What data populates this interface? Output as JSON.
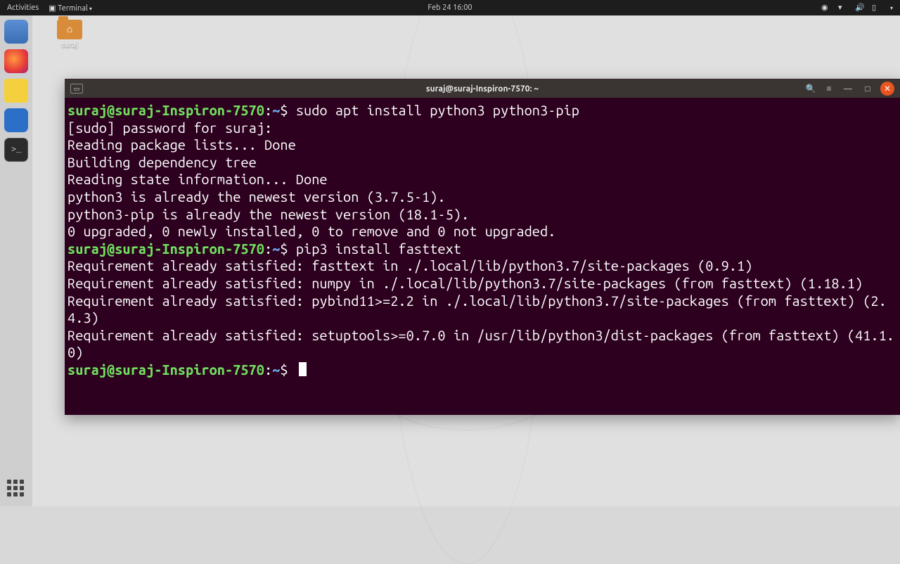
{
  "topbar": {
    "activities": "Activities",
    "app_menu": "Terminal",
    "clock": "Feb 24 16:00"
  },
  "desktop": {
    "folder_label": "suraj"
  },
  "window": {
    "title": "suraj@suraj-Inspiron-7570: ~"
  },
  "terminal": {
    "prompt_user": "suraj@suraj-Inspiron-7570",
    "prompt_sep": ":",
    "prompt_path": "~",
    "prompt_end": "$ ",
    "lines": {
      "cmd1": "sudo apt install python3 python3-pip",
      "o1": "[sudo] password for suraj:",
      "o2": "Reading package lists... Done",
      "o3": "Building dependency tree",
      "o4": "Reading state information... Done",
      "o5": "python3 is already the newest version (3.7.5-1).",
      "o6": "python3-pip is already the newest version (18.1-5).",
      "o7": "0 upgraded, 0 newly installed, 0 to remove and 0 not upgraded.",
      "cmd2": "pip3 install fasttext",
      "o8": "Requirement already satisfied: fasttext in ./.local/lib/python3.7/site-packages (0.9.1)",
      "o9": "Requirement already satisfied: numpy in ./.local/lib/python3.7/site-packages (from fasttext) (1.18.1)",
      "o10": "Requirement already satisfied: pybind11>=2.2 in ./.local/lib/python3.7/site-packages (from fasttext) (2.4.3)",
      "o11": "Requirement already satisfied: setuptools>=0.7.0 in /usr/lib/python3/dist-packages (from fasttext) (41.1.0)"
    }
  }
}
